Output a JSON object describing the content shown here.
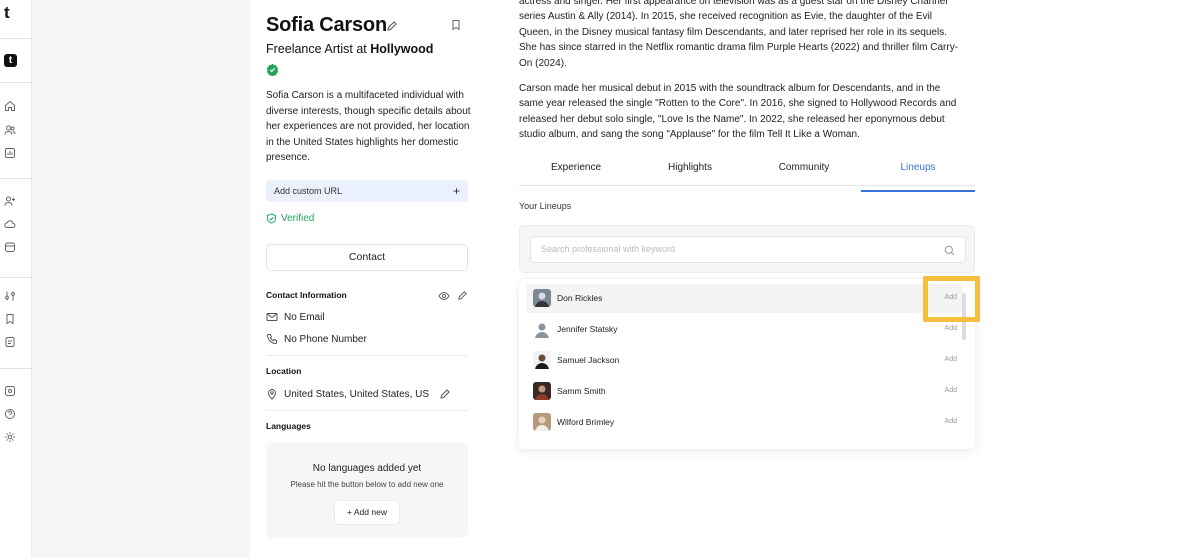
{
  "rail": {
    "logo_letter": "t",
    "logo_box_letter": "t",
    "icons": [
      "home-icon",
      "users-icon",
      "chart-icon",
      "user-add-icon",
      "cloud-icon",
      "archive-icon",
      "sliders-icon",
      "bookmark-icon",
      "document-icon",
      "puzzle-icon",
      "help-icon",
      "settings-icon"
    ]
  },
  "profile": {
    "name": "Sofia Carson",
    "title_prefix": "Freelance Artist at",
    "title_company": "Hollywood",
    "bio": "Sofia Carson is a multifaceted individual with diverse interests, though specific details about her experiences are not provided, her location in the United States highlights her domestic presence.",
    "custom_url_label": "Add custom URL",
    "custom_url_plus": "+",
    "verified_label": "Verified",
    "contact_button": "Contact",
    "contact_info_title": "Contact Information",
    "email": "No Email",
    "phone": "No Phone Number",
    "location_title": "Location",
    "location": "United States, United States, US",
    "languages_title": "Languages",
    "languages_empty_title": "No languages added yet",
    "languages_empty_hint": "Please hit the button below to add new one",
    "add_new_button": "+ Add new"
  },
  "content": {
    "para1": "actress and singer. Her first appearance on television was as a guest star on the Disney Channel series Austin & Ally (2014). In 2015, she received recognition as Evie, the daughter of the Evil Queen, in the Disney musical fantasy film Descendants, and later reprised her role in its sequels. She has since starred in the Netflix romantic drama film Purple Hearts (2022) and thriller film Carry-On (2024).",
    "para2": "Carson made her musical debut in 2015 with the soundtrack album for Descendants, and in the same year released the single \"Rotten to the Core\". In 2016, she signed to Hollywood Records and released her debut solo single, \"Love Is the Name\". In 2022, she released her eponymous debut studio album, and sang the song \"Applause\" for the film Tell It Like a Woman.",
    "tabs": [
      {
        "label": "Experience"
      },
      {
        "label": "Highlights"
      },
      {
        "label": "Community"
      },
      {
        "label": "Lineups"
      }
    ],
    "active_tab": "Lineups",
    "lineups_title": "Your Lineups",
    "search_placeholder": "Search professional with keyword",
    "people": [
      {
        "name": "Don Rickles",
        "action": "Add"
      },
      {
        "name": "Jennifer Statsky",
        "action": "Add"
      },
      {
        "name": "Samuel Jackson",
        "action": "Add"
      },
      {
        "name": "Samm Smith",
        "action": "Add"
      },
      {
        "name": "Wilford Brimley",
        "action": "Add"
      }
    ]
  },
  "colors": {
    "accent": "#3b73d9",
    "verified": "#22a55b",
    "highlight": "#f5be3d"
  }
}
